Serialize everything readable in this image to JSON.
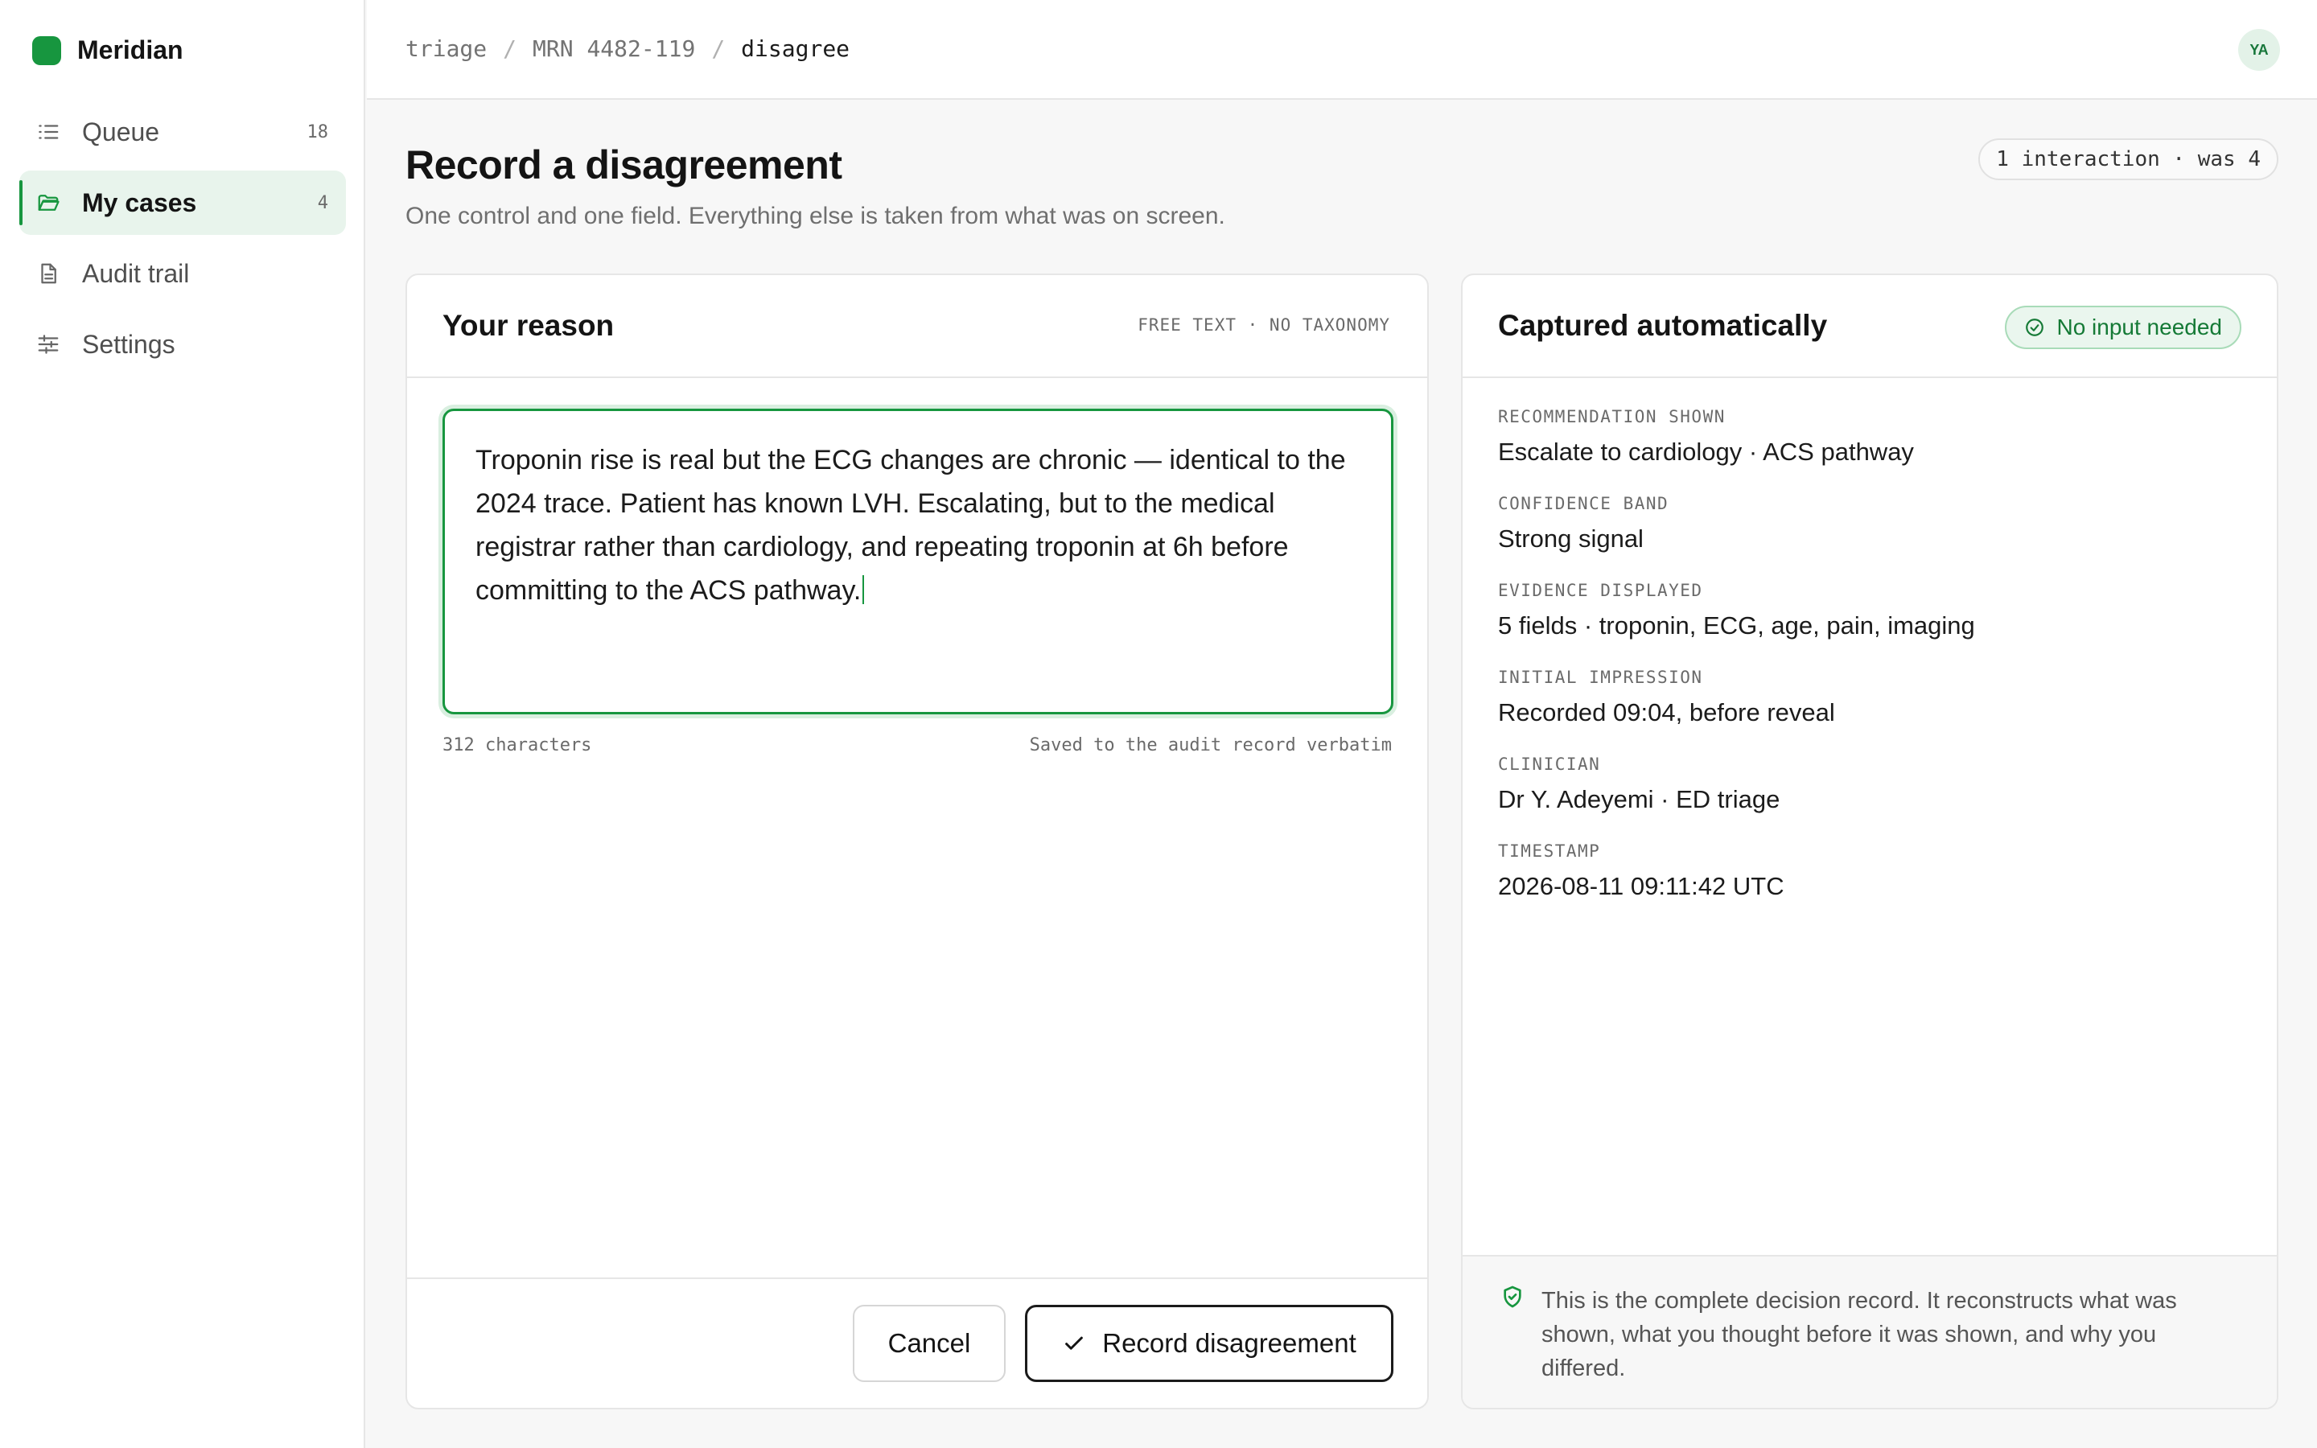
{
  "app": {
    "name": "Meridian"
  },
  "sidebar": {
    "items": [
      {
        "label": "Queue",
        "count": "18",
        "icon": "list-icon",
        "active": false
      },
      {
        "label": "My cases",
        "count": "4",
        "icon": "folder-icon",
        "active": true
      },
      {
        "label": "Audit trail",
        "count": "",
        "icon": "document-icon",
        "active": false
      },
      {
        "label": "Settings",
        "count": "",
        "icon": "sliders-icon",
        "active": false
      }
    ]
  },
  "breadcrumb": [
    "triage",
    "MRN 4482-119",
    "disagree"
  ],
  "user": {
    "initials": "YA"
  },
  "page": {
    "title": "Record a disagreement",
    "subtitle": "One control and one field. Everything else is taken from what was on screen.",
    "interaction_badge": "1 interaction · was 4"
  },
  "reason_card": {
    "title": "Your reason",
    "tag": "FREE TEXT · NO TAXONOMY",
    "text": "Troponin rise is real but the ECG changes are chronic — identical to the 2024 trace. Patient has known LVH. Escalating, but to the medical registrar rather than cardiology, and repeating troponin at 6h before committing to the ACS pathway.",
    "char_count": "312 characters",
    "saved_note": "Saved to the audit record verbatim",
    "cancel_label": "Cancel",
    "record_label": "Record disagreement"
  },
  "auto_card": {
    "title": "Captured automatically",
    "badge": "No input needed",
    "fields": [
      {
        "label": "RECOMMENDATION SHOWN",
        "value": "Escalate to cardiology · ACS pathway"
      },
      {
        "label": "CONFIDENCE BAND",
        "value": "Strong signal"
      },
      {
        "label": "EVIDENCE DISPLAYED",
        "value": "5 fields · troponin, ECG, age, pain, imaging"
      },
      {
        "label": "INITIAL IMPRESSION",
        "value": "Recorded 09:04, before reveal"
      },
      {
        "label": "CLINICIAN",
        "value": "Dr Y. Adeyemi · ED triage"
      },
      {
        "label": "TIMESTAMP",
        "value": "2026-08-11 09:11:42 UTC"
      }
    ],
    "footer": "This is the complete decision record. It reconstructs what was shown, what you thought before it was shown, and why you differed."
  },
  "colors": {
    "accent": "#17963f",
    "accent_soft": "#e8f4ec"
  }
}
